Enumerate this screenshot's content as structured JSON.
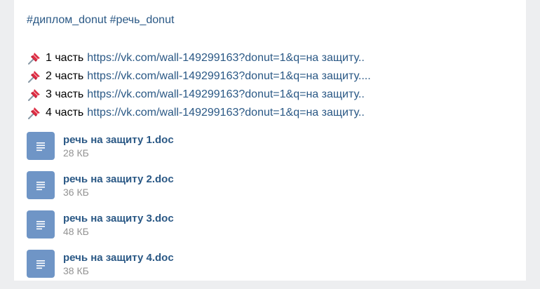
{
  "post": {
    "hashtags": [
      "#диплом_donut",
      "#речь_donut"
    ],
    "parts": [
      {
        "label": "1 часть",
        "link": "https://vk.com/wall-149299163?donut=1&q=на защиту.."
      },
      {
        "label": "2 часть",
        "link": "https://vk.com/wall-149299163?donut=1&q=на защиту...."
      },
      {
        "label": "3 часть",
        "link": "https://vk.com/wall-149299163?donut=1&q=на защиту.."
      },
      {
        "label": "4 часть",
        "link": "https://vk.com/wall-149299163?donut=1&q=на защиту.."
      }
    ],
    "documents": [
      {
        "name": "речь на защиту 1.doc",
        "size": "28 КБ"
      },
      {
        "name": "речь на защиту 2.doc",
        "size": "36 КБ"
      },
      {
        "name": "речь на защиту 3.doc",
        "size": "48 КБ"
      },
      {
        "name": "речь на защиту 4.doc",
        "size": "38 КБ"
      }
    ]
  },
  "icons": {
    "pin": "pushpin-icon",
    "document": "document-icon"
  },
  "colors": {
    "link": "#2a5885",
    "doc_icon_bg": "#6f95c6",
    "muted": "#939393",
    "page_bg": "#edeef0",
    "pin_red": "#dd2e44"
  }
}
